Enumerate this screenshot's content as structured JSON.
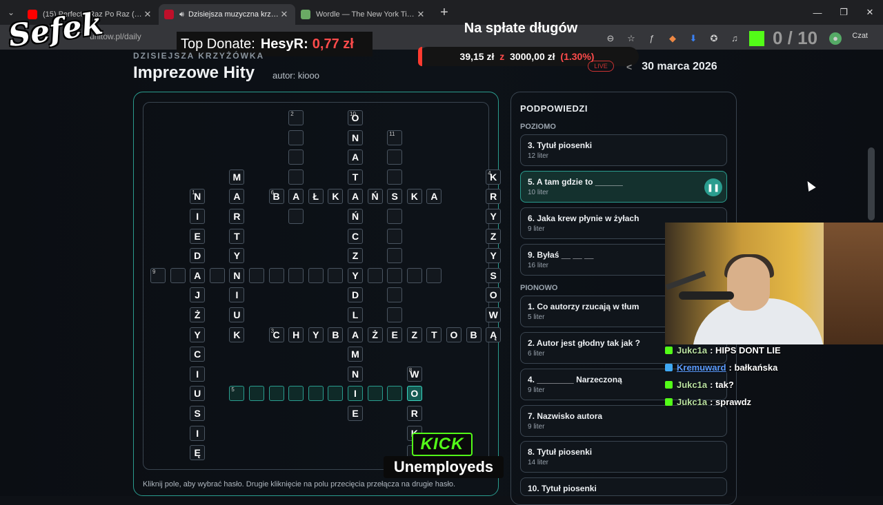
{
  "tabs": [
    {
      "title": "(15) Perfect - Raz Po Raz (Strasza M",
      "favicon_color": "#ff0000"
    },
    {
      "title": "Dzisiejsza muzyczna krzyżówk",
      "favicon_color": "#c0102a"
    },
    {
      "title": "Wordle — The New York Times",
      "favicon_color": "#6aaa64"
    }
  ],
  "address": {
    "url": "unitow.pl/daily"
  },
  "toolbar": {
    "czat_label": "Czat",
    "score_counter": "0 / 10"
  },
  "overlay": {
    "streamer_name": "Sefek",
    "top_donate_label": "Top Donate:",
    "top_donate_user": "HesyR:",
    "top_donate_amount": "0,77 zł",
    "goal_title": "Na spłate długów",
    "goal_current": "39,15 zł",
    "goal_sep": "z",
    "goal_target": "3000,00 zł",
    "goal_percent": "(1.30%)",
    "goal_progress": 0.013,
    "live_label": "LIVE",
    "kick_label": "KICK",
    "channel_label": "Unemployeds"
  },
  "puzzle": {
    "eyebrow": "DZISIEJSZA KRZYŻÓWKA",
    "title": "Imprezowe Hity",
    "author": "autor: kiooo",
    "date": "30 marca 2026",
    "bottom_hint": "Kliknij pole, aby wybrać hasło. Drugie kliknięcie na polu przecięcia przełącza na drugie hasło."
  },
  "clues": {
    "title": "PODPOWIEDZI",
    "across_label": "POZIOMO",
    "down_label": "PIONOWO",
    "across": [
      {
        "t": "3. Tytuł piosenki",
        "s": "12 liter"
      },
      {
        "t": "5. A tam gdzie to ______",
        "s": "10 liter"
      },
      {
        "t": "6. Jaka krew płynie w żyłach",
        "s": "9 liter"
      },
      {
        "t": "9. Byłaś __ __ __",
        "s": "16 liter"
      }
    ],
    "down": [
      {
        "t": "1. Co autorzy rzucają w tłum",
        "s": "5 liter"
      },
      {
        "t": "2. Autor jest głodny tak jak ?",
        "s": "6 liter"
      },
      {
        "t": "4. ________ Narzeczoną",
        "s": "9 liter"
      },
      {
        "t": "7. Nazwisko autora",
        "s": "9 liter"
      },
      {
        "t": "8. Tytuł piosenki",
        "s": "14 liter"
      },
      {
        "t": "10. Tytuł piosenki",
        "s": ""
      }
    ]
  },
  "chat": [
    {
      "user": "Jukc1a",
      "msg": ": HIPS DONT LIE",
      "blue": false
    },
    {
      "user": "Kremuward",
      "msg": ": bałkańska",
      "blue": true
    },
    {
      "user": "Jukc1a",
      "msg": ": tak?",
      "blue": false
    },
    {
      "user": "Jukc1a",
      "msg": ": sprawdz",
      "blue": false
    }
  ],
  "grid": [
    {
      "c": 7,
      "r": 0,
      "n": "2",
      "l": ""
    },
    {
      "c": 10,
      "r": 0,
      "n": "10",
      "l": "O"
    },
    {
      "c": 7,
      "r": 1,
      "l": ""
    },
    {
      "c": 10,
      "r": 1,
      "l": "N"
    },
    {
      "c": 12,
      "r": 1,
      "n": "11",
      "l": ""
    },
    {
      "c": 7,
      "r": 2,
      "l": ""
    },
    {
      "c": 10,
      "r": 2,
      "l": "A"
    },
    {
      "c": 12,
      "r": 2,
      "l": ""
    },
    {
      "c": 4,
      "r": 3,
      "l": "M"
    },
    {
      "c": 7,
      "r": 3,
      "l": ""
    },
    {
      "c": 10,
      "r": 3,
      "l": "T"
    },
    {
      "c": 12,
      "r": 3,
      "l": ""
    },
    {
      "c": 17,
      "r": 3,
      "n": "4",
      "l": "K"
    },
    {
      "c": 2,
      "r": 4,
      "n": "1",
      "l": "N"
    },
    {
      "c": 4,
      "r": 4,
      "l": "A"
    },
    {
      "c": 6,
      "r": 4,
      "n": "6",
      "l": "B"
    },
    {
      "c": 7,
      "r": 4,
      "l": "A"
    },
    {
      "c": 8,
      "r": 4,
      "l": "Ł"
    },
    {
      "c": 9,
      "r": 4,
      "l": "K"
    },
    {
      "c": 10,
      "r": 4,
      "l": "A"
    },
    {
      "c": 11,
      "r": 4,
      "l": "Ń"
    },
    {
      "c": 12,
      "r": 4,
      "l": "S"
    },
    {
      "c": 13,
      "r": 4,
      "l": "K"
    },
    {
      "c": 14,
      "r": 4,
      "l": "A"
    },
    {
      "c": 17,
      "r": 4,
      "l": "R"
    },
    {
      "c": 2,
      "r": 5,
      "l": "I"
    },
    {
      "c": 4,
      "r": 5,
      "l": "R"
    },
    {
      "c": 7,
      "r": 5,
      "l": ""
    },
    {
      "c": 10,
      "r": 5,
      "l": "Ń"
    },
    {
      "c": 12,
      "r": 5,
      "l": ""
    },
    {
      "c": 17,
      "r": 5,
      "l": "Y"
    },
    {
      "c": 2,
      "r": 6,
      "l": "E"
    },
    {
      "c": 4,
      "r": 6,
      "l": "T"
    },
    {
      "c": 10,
      "r": 6,
      "l": "C"
    },
    {
      "c": 12,
      "r": 6,
      "l": ""
    },
    {
      "c": 17,
      "r": 6,
      "l": "Z"
    },
    {
      "c": 2,
      "r": 7,
      "l": "D"
    },
    {
      "c": 4,
      "r": 7,
      "l": "Y"
    },
    {
      "c": 10,
      "r": 7,
      "l": "Z"
    },
    {
      "c": 12,
      "r": 7,
      "l": ""
    },
    {
      "c": 17,
      "r": 7,
      "l": "Y"
    },
    {
      "c": 0,
      "r": 8,
      "n": "9",
      "l": ""
    },
    {
      "c": 1,
      "r": 8,
      "l": ""
    },
    {
      "c": 2,
      "r": 8,
      "l": "A"
    },
    {
      "c": 3,
      "r": 8,
      "l": ""
    },
    {
      "c": 4,
      "r": 8,
      "l": "N"
    },
    {
      "c": 5,
      "r": 8,
      "l": ""
    },
    {
      "c": 6,
      "r": 8,
      "l": ""
    },
    {
      "c": 7,
      "r": 8,
      "l": ""
    },
    {
      "c": 8,
      "r": 8,
      "l": ""
    },
    {
      "c": 9,
      "r": 8,
      "l": ""
    },
    {
      "c": 10,
      "r": 8,
      "l": "Y"
    },
    {
      "c": 11,
      "r": 8,
      "l": ""
    },
    {
      "c": 12,
      "r": 8,
      "l": ""
    },
    {
      "c": 13,
      "r": 8,
      "l": ""
    },
    {
      "c": 14,
      "r": 8,
      "l": ""
    },
    {
      "c": 17,
      "r": 8,
      "l": "S"
    },
    {
      "c": 2,
      "r": 9,
      "l": "J"
    },
    {
      "c": 4,
      "r": 9,
      "l": "I"
    },
    {
      "c": 10,
      "r": 9,
      "l": "D"
    },
    {
      "c": 12,
      "r": 9,
      "l": ""
    },
    {
      "c": 17,
      "r": 9,
      "l": "O"
    },
    {
      "c": 2,
      "r": 10,
      "l": "Ż"
    },
    {
      "c": 4,
      "r": 10,
      "l": "U"
    },
    {
      "c": 10,
      "r": 10,
      "l": "L"
    },
    {
      "c": 12,
      "r": 10,
      "l": ""
    },
    {
      "c": 17,
      "r": 10,
      "l": "W"
    },
    {
      "c": 2,
      "r": 11,
      "l": "Y"
    },
    {
      "c": 4,
      "r": 11,
      "l": "K"
    },
    {
      "c": 6,
      "r": 11,
      "n": "3",
      "l": "C"
    },
    {
      "c": 7,
      "r": 11,
      "l": "H"
    },
    {
      "c": 8,
      "r": 11,
      "l": "Y"
    },
    {
      "c": 9,
      "r": 11,
      "l": "B"
    },
    {
      "c": 10,
      "r": 11,
      "l": "A"
    },
    {
      "c": 11,
      "r": 11,
      "l": "Ż"
    },
    {
      "c": 12,
      "r": 11,
      "l": "E"
    },
    {
      "c": 13,
      "r": 11,
      "l": "Z"
    },
    {
      "c": 14,
      "r": 11,
      "l": "T"
    },
    {
      "c": 15,
      "r": 11,
      "l": "O"
    },
    {
      "c": 16,
      "r": 11,
      "l": "B"
    },
    {
      "c": 17,
      "r": 11,
      "l": "Ą"
    },
    {
      "c": 2,
      "r": 12,
      "l": "C"
    },
    {
      "c": 10,
      "r": 12,
      "l": "M"
    },
    {
      "c": 2,
      "r": 13,
      "l": "I"
    },
    {
      "c": 10,
      "r": 13,
      "l": "N"
    },
    {
      "c": 13,
      "r": 13,
      "n": "8",
      "l": "W"
    },
    {
      "c": 2,
      "r": 14,
      "l": "U"
    },
    {
      "c": 4,
      "r": 14,
      "n": "5",
      "l": "",
      "a": 1
    },
    {
      "c": 5,
      "r": 14,
      "l": "",
      "a": 1
    },
    {
      "c": 6,
      "r": 14,
      "l": "",
      "a": 1
    },
    {
      "c": 7,
      "r": 14,
      "l": "",
      "a": 1
    },
    {
      "c": 8,
      "r": 14,
      "l": "",
      "a": 1
    },
    {
      "c": 9,
      "r": 14,
      "l": "",
      "a": 1
    },
    {
      "c": 10,
      "r": 14,
      "l": "I",
      "a": 1
    },
    {
      "c": 11,
      "r": 14,
      "l": "",
      "a": 1
    },
    {
      "c": 12,
      "r": 14,
      "l": "",
      "a": 1
    },
    {
      "c": 13,
      "r": 14,
      "l": "O",
      "a": 2
    },
    {
      "c": 2,
      "r": 15,
      "l": "S"
    },
    {
      "c": 10,
      "r": 15,
      "l": "E"
    },
    {
      "c": 13,
      "r": 15,
      "l": "R"
    },
    {
      "c": 2,
      "r": 16,
      "l": "I"
    },
    {
      "c": 13,
      "r": 16,
      "l": "K"
    },
    {
      "c": 2,
      "r": 17,
      "l": "Ę"
    },
    {
      "c": 13,
      "r": 17,
      "l": "I"
    }
  ]
}
